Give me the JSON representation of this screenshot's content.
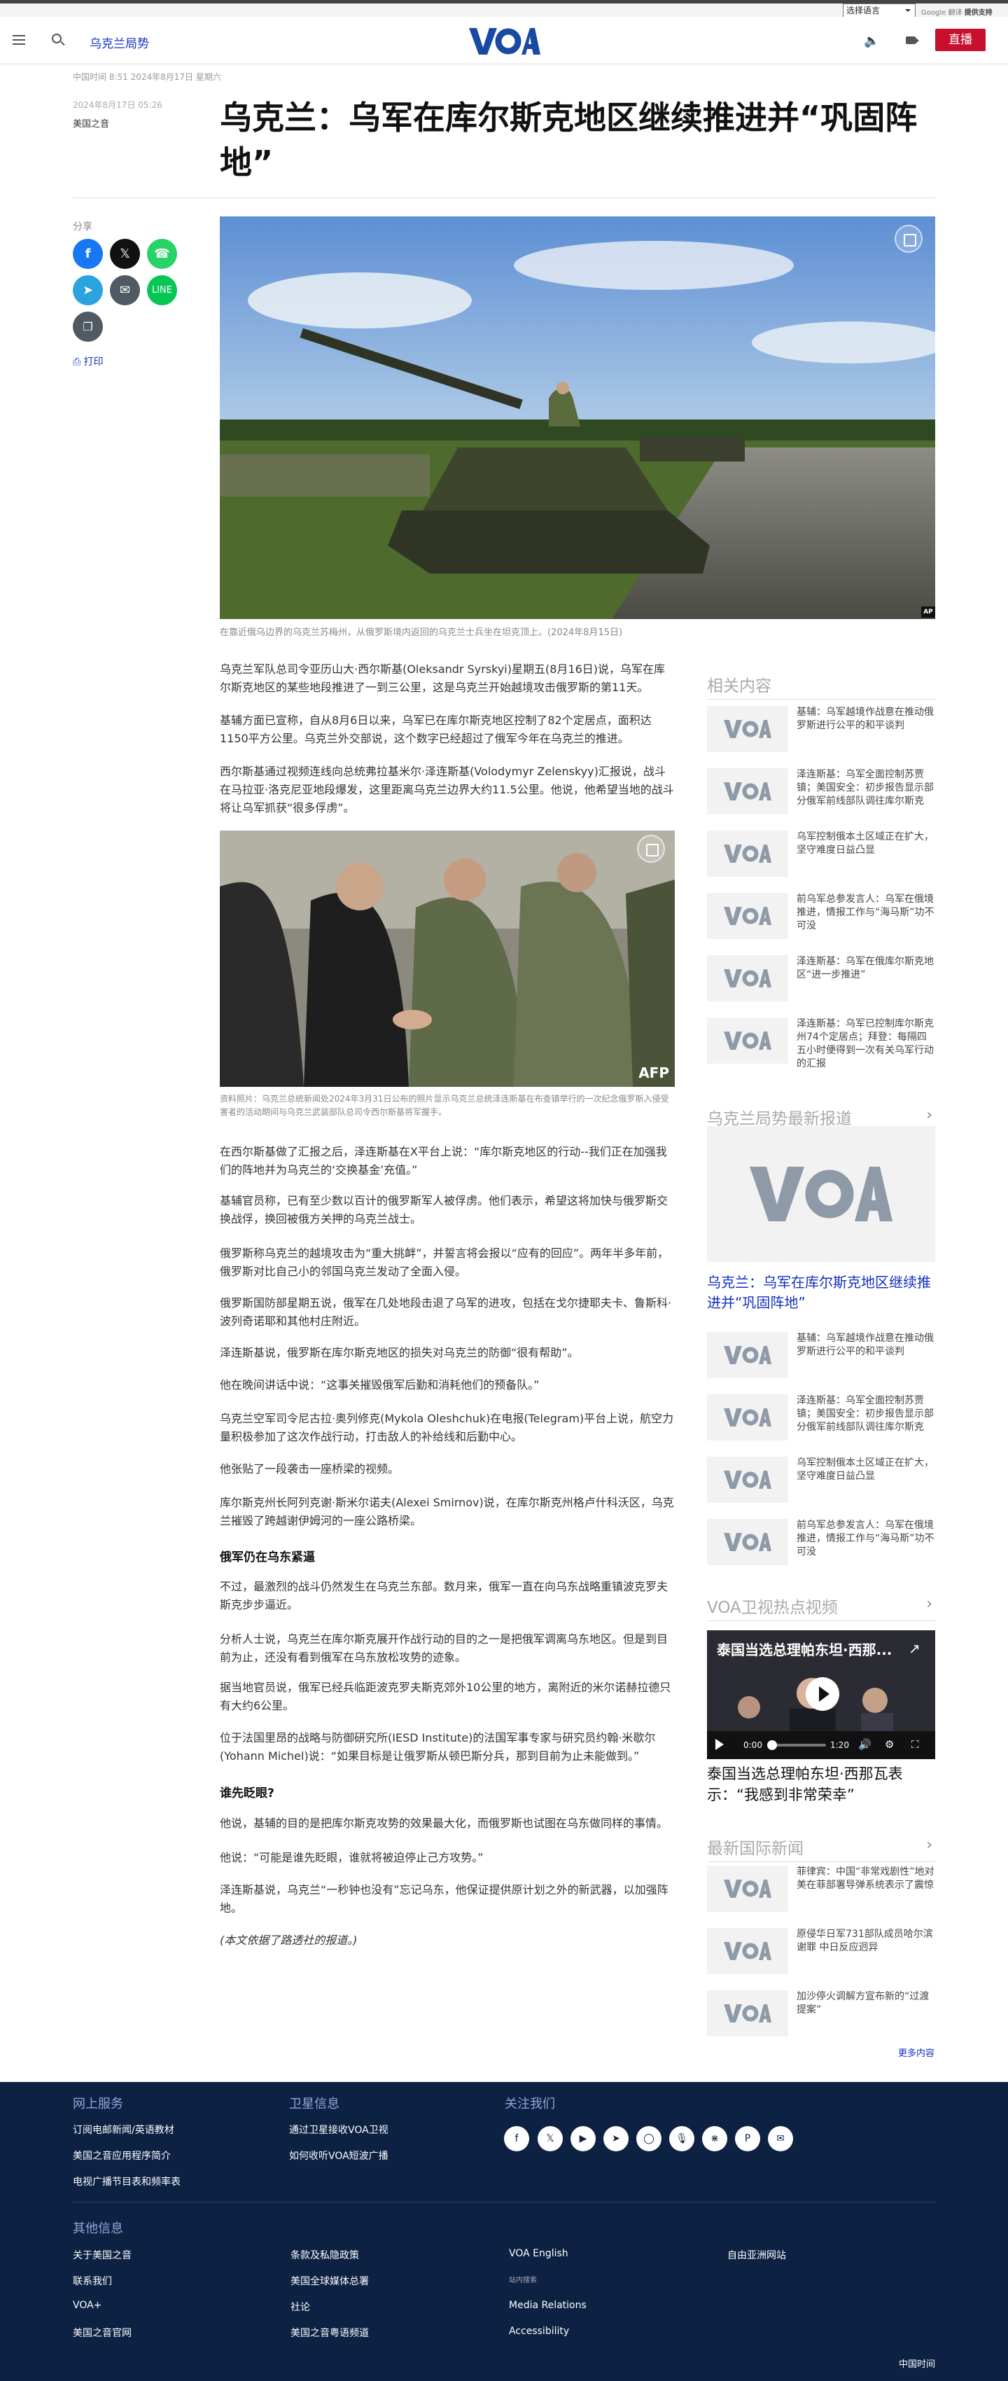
{
  "topbar": {
    "select_label": "选择语言",
    "powered_prefix": "提供支持",
    "powered_brand": "Google 翻译"
  },
  "header": {
    "section": "乌克兰局势",
    "logo_text": "VOA",
    "live_label": "直播"
  },
  "article": {
    "dateline": "中国时间 8:51 2024年8月17日 星期六",
    "date": "2024年8月17日 05:26",
    "byline": "美国之音",
    "title": "乌克兰：乌军在库尔斯克地区继续推进并“巩固阵地”",
    "share_label": "分享",
    "print_label": "打印",
    "hero_caption": "在靠近俄乌边界的乌克兰苏梅州，从俄罗斯境内返回的乌克兰士兵坐在坦克顶上。(2024年8月15日)",
    "hero_credit": "AP",
    "paragraphs_a": [
      "乌克兰军队总司令亚历山大·西尔斯基(Oleksandr Syrskyi)星期五(8月16日)说，乌军在库尔斯克地区的某些地段推进了一到三公里，这是乌克兰开始越境攻击俄罗斯的第11天。",
      "基辅方面已宣称，自从8月6日以来，乌军已在库尔斯克地区控制了82个定居点，面积达1150平方公里。乌克兰外交部说，这个数字已经超过了俄军今年在乌克兰的推进。",
      "西尔斯基通过视频连线向总统弗拉基米尔·泽连斯基(Volodymyr Zelenskyy)汇报说，战斗在马拉亚·洛克尼亚地段爆发，这里距离乌克兰边界大约11.5公里。他说，他希望当地的战斗将让乌军抓获“很多俘虏”。"
    ],
    "photo_caption": "资料照片：乌克兰总统新闻处2024年3月31日公布的照片显示乌克兰总统泽连斯基在布查镇举行的一次纪念俄罗斯入侵受害者的活动期间与乌克兰武装部队总司令西尔斯基将军握手。",
    "photo_credit": "AFP",
    "paragraphs_b": [
      "在西尔斯基做了汇报之后，泽连斯基在X平台上说：“库尔斯克地区的行动--我们正在加强我们的阵地并为乌克兰的‘交换基金’充值。”",
      "基辅官员称，已有至少数以百计的俄罗斯军人被俘虏。他们表示，希望这将加快与俄罗斯交换战俘，换回被俄方关押的乌克兰战士。",
      "俄罗斯称乌克兰的越境攻击为“重大挑衅”，并誓言将会报以“应有的回应”。两年半多年前，俄罗斯对比自己小的邻国乌克兰发动了全面入侵。",
      "俄罗斯国防部星期五说，俄军在几处地段击退了乌军的进攻，包括在戈尔捷耶夫卡、鲁斯科·波列奇诺耶和其他村庄附近。",
      "泽连斯基说，俄罗斯在库尔斯克地区的损失对乌克兰的防御“很有帮助”。",
      "他在晚间讲话中说：“这事关摧毁俄军后勤和消耗他们的预备队。”",
      "乌克兰空军司令尼古拉·奥列修克(Mykola Oleshchuk)在电报(Telegram)平台上说，航空力量积极参加了这次作战行动，打击敌人的补给线和后勤中心。",
      "他张贴了一段袭击一座桥梁的视频。",
      "库尔斯克州长阿列克谢·斯米尔诺夫(Alexei Smirnov)说，在库尔斯克州格卢什科沃区，乌克兰摧毁了跨越谢伊姆河的一座公路桥梁。"
    ],
    "subhead_1": "俄军仍在乌东紧逼",
    "paragraphs_c": [
      "不过，最激烈的战斗仍然发生在乌克兰东部。数月来，俄军一直在向乌东战略重镇波克罗夫斯克步步逼近。",
      "分析人士说，乌克兰在库尔斯克展开作战行动的目的之一是把俄军调离乌东地区。但是到目前为止，还没有看到俄军在乌东放松攻势的迹象。",
      "据当地官员说，俄军已经兵临距波克罗夫斯克郊外10公里的地方，离附近的米尔诺赫拉德只有大约6公里。",
      "位于法国里昂的战略与防御研究所(IESD Institute)的法国军事专家与研究员约翰·米歇尔(Yohann Michel)说：“如果目标是让俄罗斯从顿巴斯分兵，那到目前为止未能做到。”"
    ],
    "subhead_2": "谁先眨眼?",
    "paragraphs_d": [
      "他说，基辅的目的是把库尔斯克攻势的效果最大化，而俄罗斯也试图在乌东做同样的事情。",
      "他说：“可能是谁先眨眼，谁就将被迫停止己方攻势。”",
      "泽连斯基说，乌克兰“一秒钟也没有”忘记乌东，他保证提供原计划之外的新武器，以加强阵地。"
    ],
    "source_note": "(本文依据了路透社的报道。)"
  },
  "sidebar": {
    "related_heading": "相关内容",
    "related": [
      "基辅：乌军越境作战意在推动俄罗斯进行公平的和平谈判",
      "泽连斯基：乌军全面控制苏贾镇；美国安全：初步报告显示部分俄军前线部队调往库尔斯克",
      "乌军控制俄本土区域正在扩大，坚守难度日益凸显",
      "前乌军总参发言人：乌军在俄境推进，情报工作与“海马斯”功不可没",
      "泽连斯基：乌军在俄库尔斯克地区“进一步推进”",
      "泽连斯基：乌军已控制库尔斯克州74个定居点；拜登：每隔四五小时便得到一次有关乌军行动的汇报"
    ],
    "latest_heading": "乌克兰局势最新报道",
    "latest_top": "乌克兰：乌军在库尔斯克地区继续推进并“巩固阵地”",
    "latest": [
      "基辅：乌军越境作战意在推动俄罗斯进行公平的和平谈判",
      "泽连斯基：乌军全面控制苏贾镇；美国安全：初步报告显示部分俄军前线部队调往库尔斯克",
      "乌军控制俄本土区域正在扩大，坚守难度日益凸显",
      "前乌军总参发言人：乌军在俄境推进，情报工作与“海马斯”功不可没"
    ],
    "video_heading": "VOA卫视热点视频",
    "video_title": "泰国当选总理帕东坦·西那瓦表示：“我感到非常荣幸”",
    "video_overlay_title": "泰国当选总理帕东坦·西那...",
    "video_time_current": "0:00",
    "video_time_total": "1:20",
    "intl_heading": "最新国际新闻",
    "intl": [
      "菲律宾：中国“非常戏剧性”地对美在菲部署导弹系统表示了震惊",
      "原侵华日军731部队成员哈尔滨谢罪 中日反应迥异",
      "加沙停火调解方宣布新的“过渡提案”"
    ],
    "more_label": "更多内容"
  },
  "footer": {
    "col1_heading": "网上服务",
    "col1": [
      "订阅电邮新闻/英语教材",
      "美国之音应用程序简介",
      "电视广播节目表和频率表"
    ],
    "col2_heading": "卫星信息",
    "col2": [
      "通过卫星接收VOA卫视",
      "如何收听VOA短波广播"
    ],
    "col3_heading": "关注我们",
    "social_icons": [
      "facebook-icon",
      "x-icon",
      "youtube-icon",
      "telegram-icon",
      "instagram-icon",
      "podcast-icon",
      "rss-icon",
      "pinterest-icon",
      "email-icon"
    ],
    "other_heading": "其他信息",
    "other_col1": [
      "关于美国之音",
      "联系我们",
      "VOA+",
      "美国之音官网"
    ],
    "other_col2": [
      "条款及私隐政策",
      "美国全球媒体总署",
      "社论",
      "美国之音粤语频道"
    ],
    "other_col3": [
      "VOA English",
      "站内搜索",
      "Media Relations",
      "Accessibility"
    ],
    "other_col4": [
      "自由亚洲网站"
    ],
    "bottom_time": "中国时间"
  }
}
